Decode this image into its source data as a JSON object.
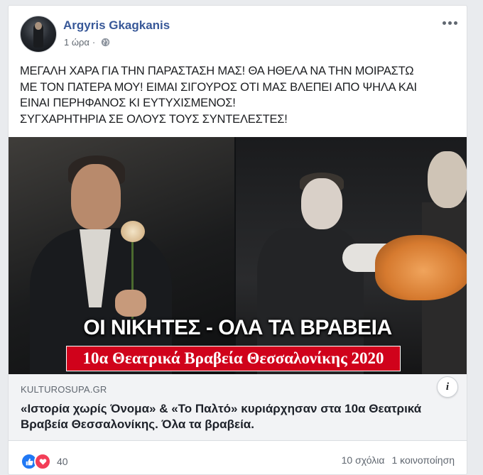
{
  "post": {
    "author": "Argyris Gkagkanis",
    "time": "1 ώρα",
    "privacy_icon": "globe-icon",
    "menu_icon": "more-icon",
    "text_lines": [
      "ΜΕΓΑΛΗ ΧΑΡΑ ΓΙΑ ΤΗΝ ΠΑΡΑΣΤΑΣΗ ΜΑΣ! ΘΑ ΗΘΕΛΑ ΝΑ ΤΗΝ ΜΟΙΡΑΣΤΩ",
      "ΜΕ ΤΟΝ ΠΑΤΕΡΑ ΜΟΥ! ΕΙΜΑΙ ΣΙΓΟΥΡΟΣ ΟΤΙ ΜΑΣ ΒΛΕΠΕΙ ΑΠΟ ΨΗΛΑ ΚΑΙ",
      "ΕΙΝΑΙ ΠΕΡΗΦΑΝΟΣ ΚΙ ΕΥΤΥΧΙΣΜΕΝΟΣ!",
      "ΣΥΓΧΑΡΗΤΗΡΙΑ ΣΕ ΟΛΟΥΣ ΤΟΥΣ ΣΥΝΤΕΛΕΣΤΕΣ!"
    ]
  },
  "media": {
    "headline": "ΟΙ ΝΙΚΗΤΕΣ - ΟΛΑ ΤΑ ΒΡΑΒΕΙΑ",
    "banner": "10α Θεατρικά Βραβεία Θεσσαλονίκης 2020",
    "banner_color": "#d0021b",
    "info_label": "i"
  },
  "link": {
    "domain": "KULTUROSUPA.GR",
    "title": "«Ιστορία χωρίς Όνομα» & «Το Παλτό» κυριάρχησαν στα 10α Θεατρικά Βραβεία Θεσσαλονίκης. Όλα τα βραβεία."
  },
  "footer": {
    "reaction_count": "40",
    "comments": "10 σχόλια",
    "shares": "1 κοινοποίηση",
    "like_color": "#2078f4",
    "love_color": "#f33e58"
  },
  "colors": {
    "author_link": "#385898",
    "background": "#e9ebee"
  }
}
